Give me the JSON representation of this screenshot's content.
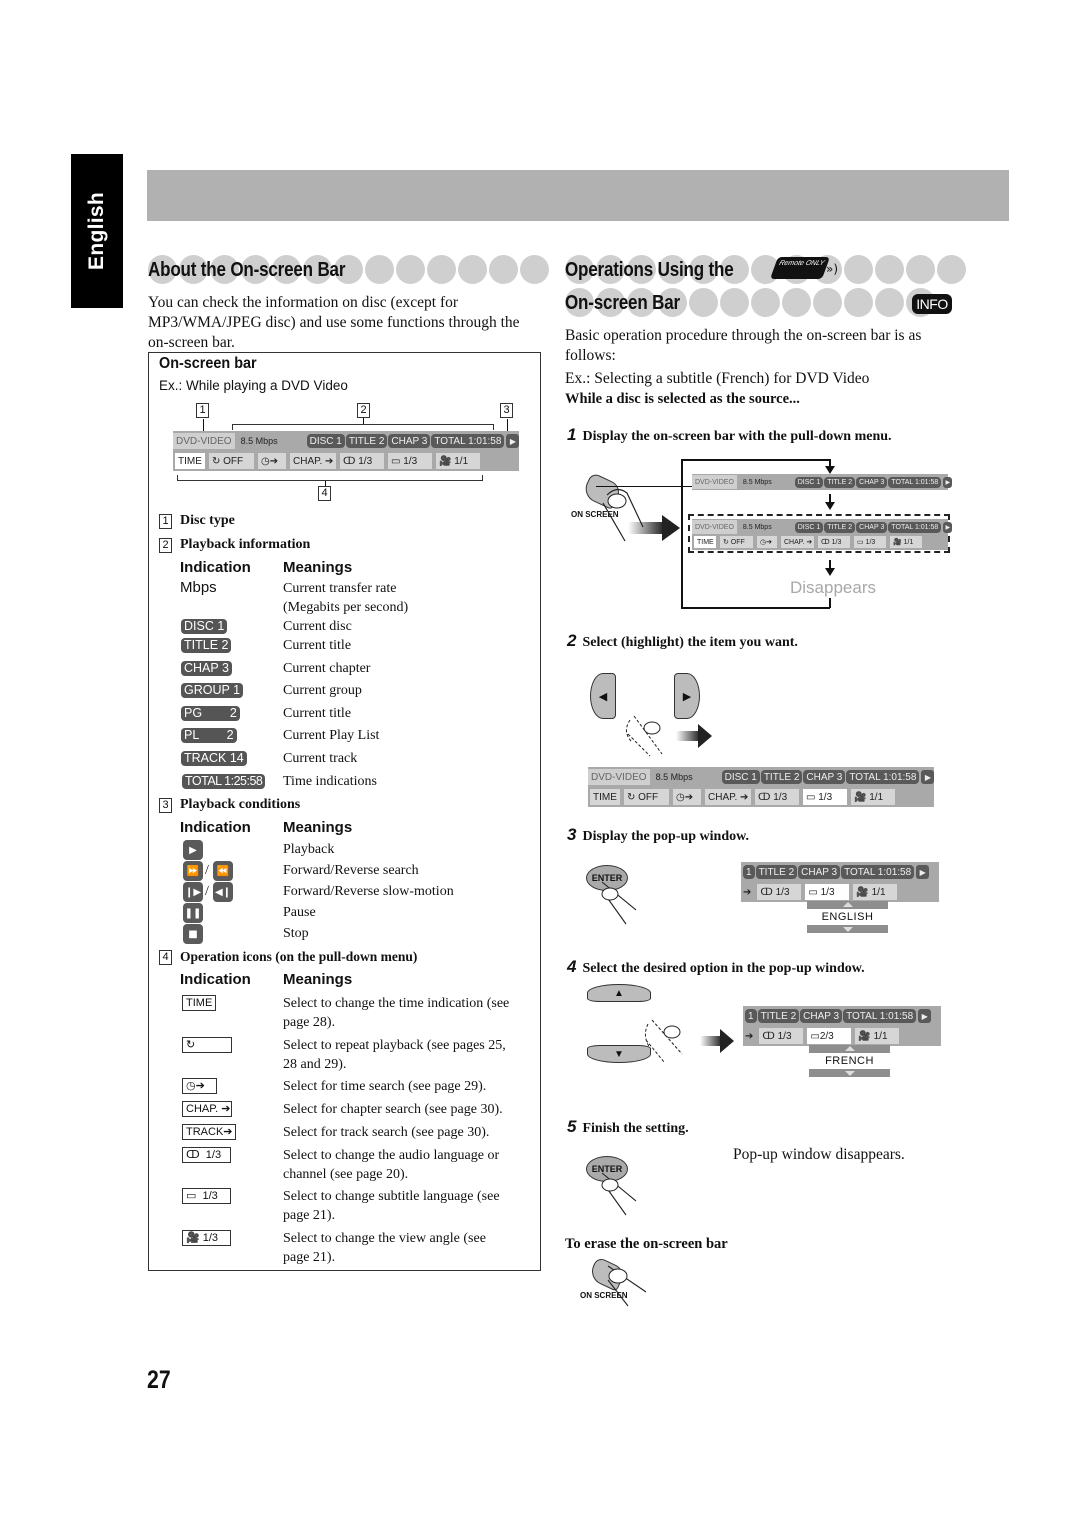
{
  "sidebar": {
    "language": "English"
  },
  "left": {
    "title": "About the On-screen Bar",
    "intro": [
      "You can check the information on disc (except for",
      "MP3/WMA/JPEG disc) and use some functions through the",
      "on-screen bar."
    ],
    "box": {
      "heading": "On-screen bar",
      "example": "Ex.: While playing a DVD Video",
      "callouts": [
        "1",
        "2",
        "3",
        "4"
      ],
      "bar": {
        "disc_type": "DVD-VIDEO",
        "rate": "8.5 Mbps",
        "disc": "DISC  1",
        "title": "TITLE  2",
        "chap": "CHAP  3",
        "total": "TOTAL  1:01:58",
        "play": "▶",
        "time": "TIME",
        "repeat": "↻ OFF",
        "time_search": "◷➔",
        "chap_search": "CHAP. ➔",
        "audio": "ↀ 1/3",
        "subtitle": "▭ 1/3",
        "angle": "🎥 1/1"
      },
      "sections": [
        {
          "num": "1",
          "label": "Disc type"
        },
        {
          "num": "2",
          "label": "Playback information"
        },
        {
          "num": "3",
          "label": "Playback conditions"
        },
        {
          "num": "4",
          "label": "Operation icons (on the pull-down menu)"
        }
      ],
      "col_indication": "Indication",
      "col_meanings": "Meanings",
      "playback_info": [
        {
          "ind": "Mbps",
          "meaning": "Current transfer rate",
          "meaning2": "(Megabits per second)"
        },
        {
          "ind": "DISC  1",
          "meaning": "Current disc"
        },
        {
          "ind": "TITLE  2",
          "meaning": "Current title"
        },
        {
          "ind": "CHAP  3",
          "meaning": "Current chapter"
        },
        {
          "ind": "GROUP 1",
          "meaning": "Current group"
        },
        {
          "ind": "PG        2",
          "meaning": "Current title"
        },
        {
          "ind": "PL        2",
          "meaning": "Current Play List"
        },
        {
          "ind": "TRACK 14",
          "meaning": "Current track"
        },
        {
          "ind": "TOTAL 1:25:58",
          "meaning": "Time indications"
        }
      ],
      "playback_conditions": [
        {
          "icon": "▶",
          "meaning": "Playback"
        },
        {
          "icon": "⏩",
          "icon2": "⏪",
          "meaning": "Forward/Reverse search"
        },
        {
          "icon": "❙▶",
          "icon2": "◀❙",
          "meaning": "Forward/Reverse slow-motion"
        },
        {
          "icon": "❚❚",
          "meaning": "Pause"
        },
        {
          "icon": "■",
          "meaning": "Stop"
        }
      ],
      "slash": "/",
      "operation_icons": [
        {
          "ind": "TIME",
          "meaning": "Select to change the time indication (see",
          "meaning2": "page 28)."
        },
        {
          "ind": "↻",
          "meaning": "Select to repeat playback (see pages 25,",
          "meaning2": "28 and 29)."
        },
        {
          "ind": "◷➔",
          "meaning": "Select for time search (see page 29)."
        },
        {
          "ind": "CHAP. ➔",
          "meaning": "Select for chapter search (see page 30)."
        },
        {
          "ind": "TRACK➔",
          "meaning": "Select for track search (see page 30)."
        },
        {
          "ind": "ↀ  1/3",
          "meaning": "Select to change the audio language or",
          "meaning2": "channel (see page 20)."
        },
        {
          "ind": "▭  1/3",
          "meaning": "Select to change subtitle language (see",
          "meaning2": "page 21)."
        },
        {
          "ind": "🎥 1/3",
          "meaning": "Select to change the view angle (see",
          "meaning2": "page 21)."
        }
      ]
    }
  },
  "right": {
    "title_line1": "Operations Using the",
    "title_line2": "On-screen Bar",
    "remote_badge": "Remote ONLY",
    "remote_waves": "»)",
    "info_badge": "INFO",
    "intro": [
      "Basic operation procedure through the on-screen bar is as",
      "follows:"
    ],
    "example": "Ex.: Selecting a subtitle (French) for DVD Video",
    "precondition": "While a disc is selected as the source...",
    "steps": [
      {
        "n": "1",
        "text": "Display the on-screen bar with the pull-down menu."
      },
      {
        "n": "2",
        "text": "Select (highlight) the item you want."
      },
      {
        "n": "3",
        "text": "Display the pop-up window."
      },
      {
        "n": "4",
        "text": "Select the desired option in the pop-up window."
      },
      {
        "n": "5",
        "text": "Finish the setting."
      }
    ],
    "on_screen_button": "ON SCREEN",
    "enter_button": "ENTER",
    "left_button": "◀",
    "right_button": "▶",
    "up_button": "▲",
    "down_button": "▼",
    "disappears": "Disappears",
    "popup_step3": {
      "option": "ENGLISH",
      "subtitle": "1/3"
    },
    "popup_step4": {
      "option": "FRENCH",
      "subtitle": "2/3"
    },
    "popup_closed_note": "Pop-up window disappears.",
    "erase_heading": "To erase the on-screen bar"
  },
  "page_number": "27"
}
